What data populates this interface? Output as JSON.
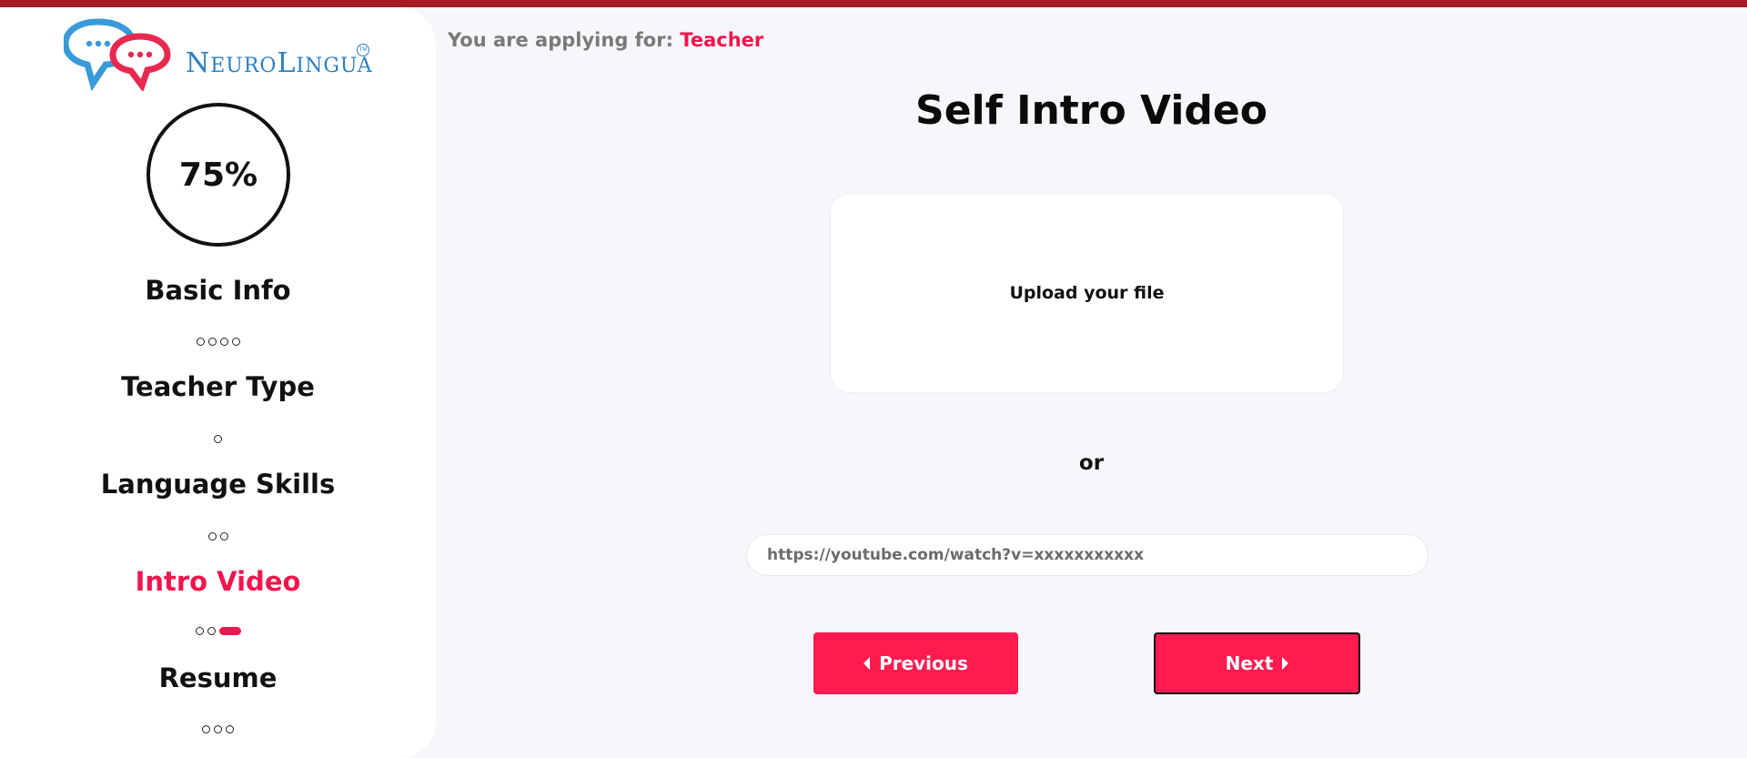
{
  "brand": {
    "logo_text_first": "N",
    "logo_text_first_rest": "EURO",
    "logo_text_second": "L",
    "logo_text_second_rest": "INGUA",
    "tm": "TM",
    "primary_color": "#2b7fc3",
    "accent_color": "#f0164d"
  },
  "header": {
    "applying_label": "You are applying for:",
    "applying_role": "Teacher"
  },
  "sidebar": {
    "progress_text": "75%",
    "progress": 0.75,
    "steps": [
      {
        "label": "Basic Info",
        "substeps": 4,
        "active_substep": null
      },
      {
        "label": "Teacher Type",
        "substeps": 1,
        "active_substep": null
      },
      {
        "label": "Language Skills",
        "substeps": 2,
        "active_substep": null
      },
      {
        "label": "Intro Video",
        "substeps": 3,
        "active_substep": 3,
        "active": true
      },
      {
        "label": "Resume",
        "substeps": 3,
        "active_substep": null
      }
    ]
  },
  "main": {
    "title": "Self Intro Video",
    "upload_label": "Upload your file",
    "or_label": "or",
    "url_placeholder": "https://youtube.com/watch?v=xxxxxxxxxxx",
    "url_value": "",
    "previous_label": "Previous",
    "next_label": "Next"
  }
}
